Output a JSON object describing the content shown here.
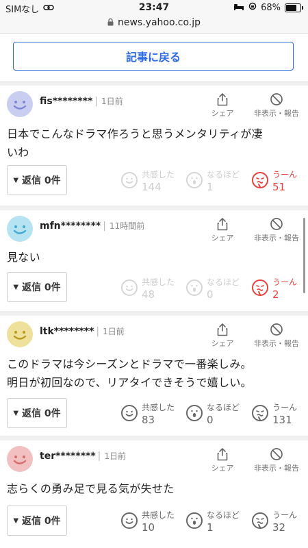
{
  "status": {
    "carrier": "SIMなし",
    "time": "23:47",
    "battery": "68%"
  },
  "url": "news.yahoo.co.jp",
  "back_label": "記事に戻る",
  "labels": {
    "share": "シェア",
    "hide": "非表示・報告",
    "reply": "返信 0件",
    "empathy": "共感した",
    "indeed": "なるほど",
    "hmm": "うーん"
  },
  "comments": [
    {
      "user": "fis********",
      "ago": "1日前",
      "line1": "日本でこんなドラマ作ろうと思うメンタリティが凄",
      "line2": "いわ",
      "empathy": "144",
      "indeed": "1",
      "hmm": "51",
      "avatar_color": "#c9cdf0",
      "face_color": "#7d86d8"
    },
    {
      "user": "mfn********",
      "ago": "11時間前",
      "line1": "見ない",
      "line2": "",
      "empathy": "48",
      "indeed": "0",
      "hmm": "2",
      "avatar_color": "#b6e3f2",
      "face_color": "#3fa8d4"
    },
    {
      "user": "ltk********",
      "ago": "1日前",
      "line1": "このドラマは今シーズンとドラマで一番楽しみ。",
      "line2": "明日が初回なので、リアタイできそうで嬉しい。",
      "empathy": "83",
      "indeed": "0",
      "hmm": "131",
      "avatar_color": "#efe19b",
      "face_color": "#b99a1f"
    },
    {
      "user": "ter********",
      "ago": "1日前",
      "line1": "志らくの勇み足で見る気が失せた",
      "line2": "",
      "empathy": "10",
      "indeed": "1",
      "hmm": "32",
      "avatar_color": "#f2c0c0",
      "face_color": "#d86c6c"
    }
  ],
  "colors": {
    "accent": "#2d6be4",
    "hmm_active": "#e8413c"
  }
}
